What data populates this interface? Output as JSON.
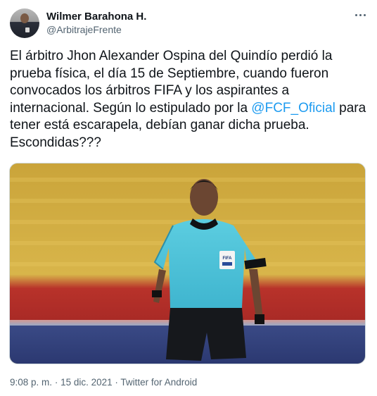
{
  "author": {
    "display_name": "Wilmer Barahona H.",
    "handle": "@ArbitrajeFrente"
  },
  "tweet": {
    "text_before": "El árbitro Jhon Alexander Ospina del Quindío perdió la prueba física, el día 15 de Septiembre, cuando fueron convocados los árbitros FIFA y los aspirantes a internacional. Según lo estipulado por la ",
    "mention": "@FCF_Oficial",
    "text_after": " para tener está escarapela, debían ganar dicha prueba. Escondidas???"
  },
  "media": {
    "alt": "Referee in light blue FIFA shirt in a stadium",
    "badge_text": "FIFA"
  },
  "meta": {
    "time": "9:08 p. m.",
    "separator": "·",
    "date": "15 dic. 2021",
    "source": "Twitter for Android"
  },
  "colors": {
    "accent": "#1d9bf0",
    "text": "#0f1419",
    "secondary": "#536471"
  },
  "icons": {
    "more": "more-dots-icon"
  }
}
